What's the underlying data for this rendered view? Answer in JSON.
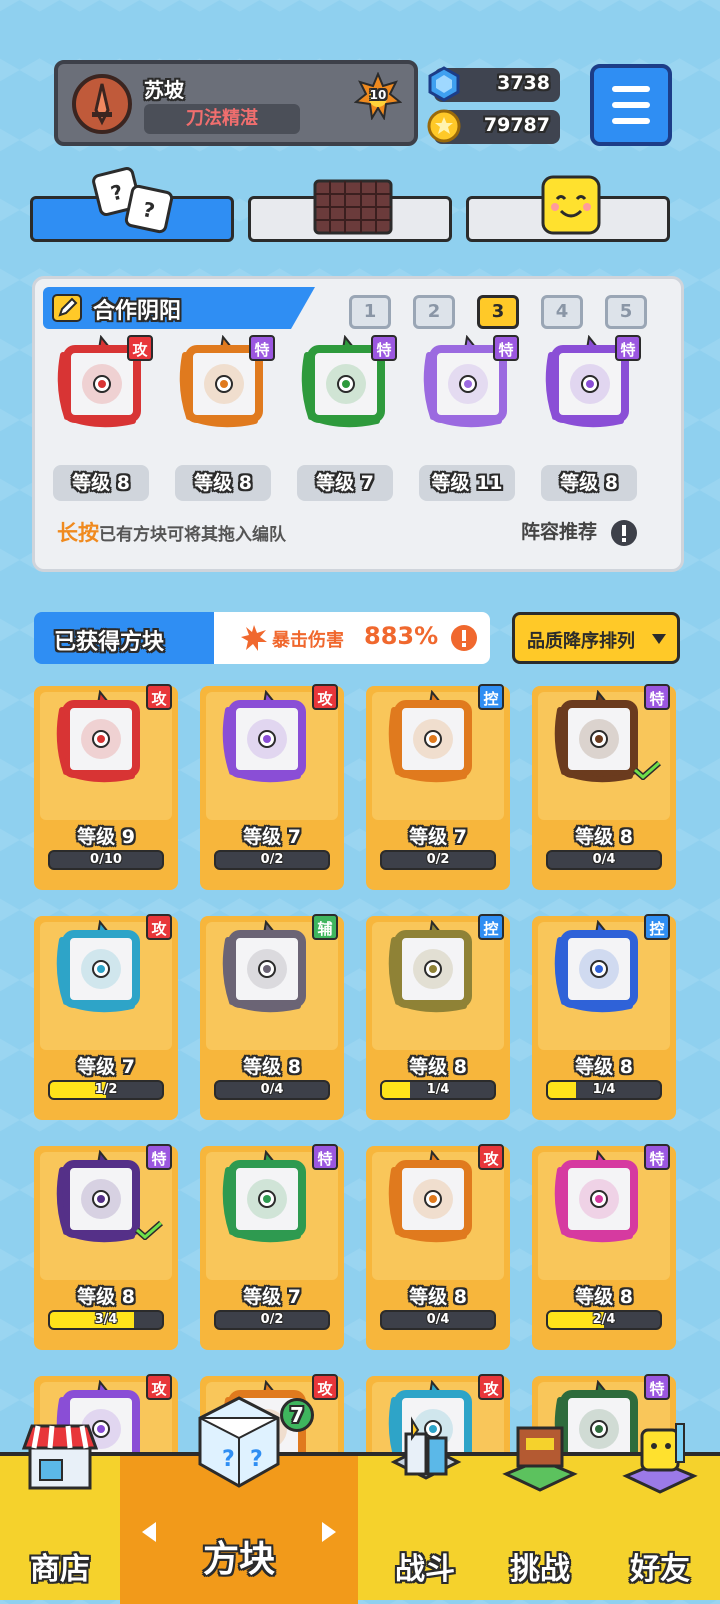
{
  "player": {
    "name": "苏坡",
    "title": "刀法精湛",
    "level": "10"
  },
  "currency": {
    "gems": "3738",
    "coins": "79787"
  },
  "team": {
    "name": "合作阴阳",
    "slots": [
      "1",
      "2",
      "3",
      "4",
      "5"
    ],
    "active_slot": "3",
    "members": [
      {
        "level": "等级 8",
        "tag": "攻",
        "tag_color": "#e8363a",
        "frame_color": "#d83434"
      },
      {
        "level": "等级 8",
        "tag": "特",
        "tag_color": "#9b57e0",
        "frame_color": "#e07a1e"
      },
      {
        "level": "等级 7",
        "tag": "特",
        "tag_color": "#9b57e0",
        "frame_color": "#2e9a3c"
      },
      {
        "level": "等级 11",
        "tag": "特",
        "tag_color": "#9b57e0",
        "frame_color": "#9b6ae0"
      },
      {
        "level": "等级 8",
        "tag": "特",
        "tag_color": "#9b57e0",
        "frame_color": "#8a4ed6"
      }
    ],
    "hint_highlight": "长按",
    "hint_text": "已有方块可将其拖入编队",
    "recommend_label": "阵容推荐"
  },
  "owned": {
    "title": "已获得方块",
    "crit_label": "暴击伤害",
    "crit_value": "883%",
    "sort_label": "品质降序排列",
    "blocks": [
      {
        "level": "等级 9",
        "progress": "0/10",
        "fill": 0,
        "tag": "攻",
        "tag_class": "red",
        "frame_color": "#d83434",
        "checked": false
      },
      {
        "level": "等级 7",
        "progress": "0/2",
        "fill": 0,
        "tag": "攻",
        "tag_class": "red",
        "frame_color": "#8a4ed6",
        "checked": false
      },
      {
        "level": "等级 7",
        "progress": "0/2",
        "fill": 0,
        "tag": "控",
        "tag_class": "blue",
        "frame_color": "#e07a1e",
        "checked": false
      },
      {
        "level": "等级 8",
        "progress": "0/4",
        "fill": 0,
        "tag": "特",
        "tag_class": "purple",
        "frame_color": "#6b3b1e",
        "checked": true
      },
      {
        "level": "等级 7",
        "progress": "1/2",
        "fill": 0.5,
        "tag": "攻",
        "tag_class": "red",
        "frame_color": "#2ea4c8",
        "checked": false
      },
      {
        "level": "等级 8",
        "progress": "0/4",
        "fill": 0,
        "tag": "辅",
        "tag_class": "green",
        "frame_color": "#6b6475",
        "checked": false
      },
      {
        "level": "等级 8",
        "progress": "1/4",
        "fill": 0.25,
        "tag": "控",
        "tag_class": "blue",
        "frame_color": "#8f8236",
        "checked": false
      },
      {
        "level": "等级 8",
        "progress": "1/4",
        "fill": 0.25,
        "tag": "控",
        "tag_class": "blue",
        "frame_color": "#2f62d8",
        "checked": false
      },
      {
        "level": "等级 8",
        "progress": "3/4",
        "fill": 0.75,
        "tag": "特",
        "tag_class": "purple",
        "frame_color": "#553088",
        "checked": true
      },
      {
        "level": "等级 7",
        "progress": "0/2",
        "fill": 0,
        "tag": "特",
        "tag_class": "purple",
        "frame_color": "#2e9a50",
        "checked": false
      },
      {
        "level": "等级 8",
        "progress": "0/4",
        "fill": 0,
        "tag": "攻",
        "tag_class": "red",
        "frame_color": "#e07a1e",
        "checked": false
      },
      {
        "level": "等级 8",
        "progress": "2/4",
        "fill": 0.5,
        "tag": "特",
        "tag_class": "purple",
        "frame_color": "#d63aa0",
        "checked": false
      },
      {
        "level": "",
        "progress": "",
        "fill": 0,
        "tag": "攻",
        "tag_class": "red",
        "frame_color": "#8a4ed6",
        "checked": false
      },
      {
        "level": "",
        "progress": "",
        "fill": 0,
        "tag": "攻",
        "tag_class": "red",
        "frame_color": "#e07a1e",
        "checked": false
      },
      {
        "level": "",
        "progress": "",
        "fill": 0,
        "tag": "攻",
        "tag_class": "red",
        "frame_color": "#2ea4c8",
        "checked": false
      },
      {
        "level": "",
        "progress": "",
        "fill": 0,
        "tag": "特",
        "tag_class": "purple",
        "frame_color": "#2e6b3c",
        "checked": false
      }
    ]
  },
  "nav": {
    "shop": "商店",
    "blocks": "方块",
    "blocks_badge": "7",
    "battle": "战斗",
    "challenge": "挑战",
    "friends": "好友"
  }
}
